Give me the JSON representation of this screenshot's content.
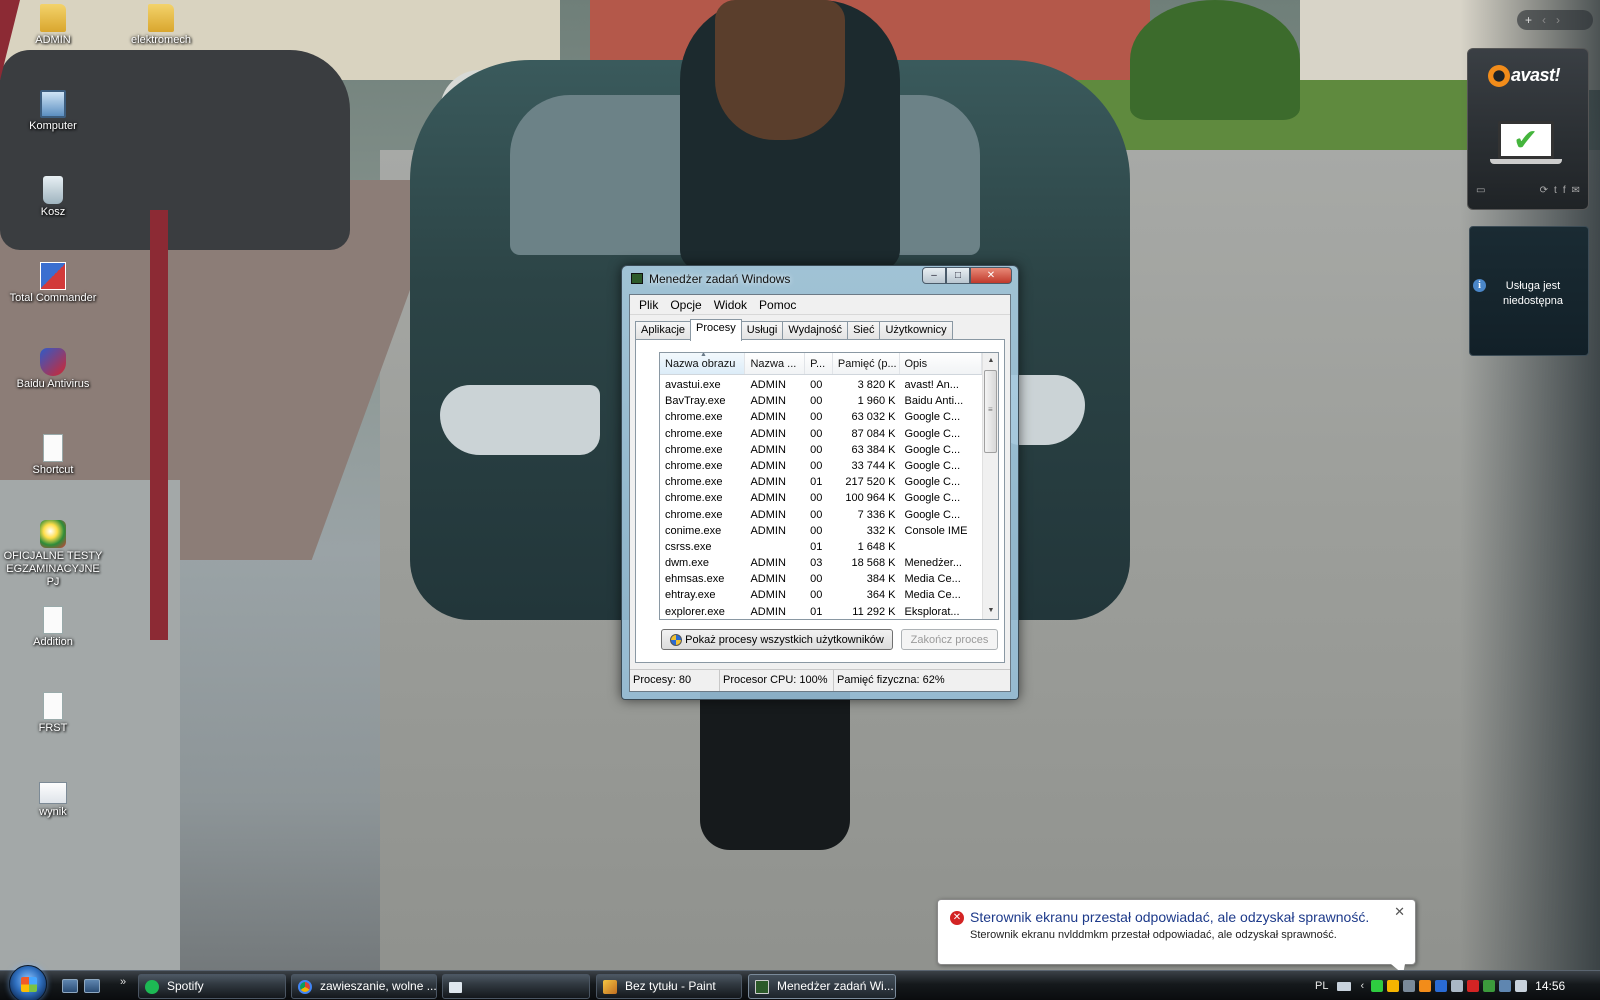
{
  "desktop": {
    "icons": [
      {
        "label": "ADMIN",
        "icon": "folder-icon"
      },
      {
        "label": "Komputer",
        "icon": "computer-icon"
      },
      {
        "label": "Kosz",
        "icon": "recycle-bin-icon"
      },
      {
        "label": "Total Commander",
        "icon": "total-commander-icon"
      },
      {
        "label": "Baidu Antivirus",
        "icon": "baidu-antivirus-icon"
      },
      {
        "label": "Shortcut",
        "icon": "document-icon"
      },
      {
        "label": "OFICJALNE TESTY EGZAMINACYJNE PJ",
        "icon": "exam-app-icon"
      },
      {
        "label": "Addition",
        "icon": "document-icon"
      },
      {
        "label": "FRST",
        "icon": "document-icon"
      },
      {
        "label": "wynik",
        "icon": "image-file-icon"
      }
    ],
    "top_icons": [
      {
        "label": "elektromech",
        "icon": "folder-icon"
      }
    ]
  },
  "task_manager": {
    "title": "Menedżer zadań Windows",
    "window_controls": {
      "minimize": "–",
      "maximize": "□",
      "close": "✕"
    },
    "menu": [
      "Plik",
      "Opcje",
      "Widok",
      "Pomoc"
    ],
    "tabs": [
      "Aplikacje",
      "Procesy",
      "Usługi",
      "Wydajność",
      "Sieć",
      "Użytkownicy"
    ],
    "active_tab": "Procesy",
    "columns": [
      "Nazwa obrazu",
      "Nazwa ...",
      "P...",
      "Pamięć (p...",
      "Opis"
    ],
    "sort_indicator": "▲",
    "rows": [
      {
        "name": "avastui.exe",
        "user": "ADMIN",
        "cpu": "00",
        "mem": "3 820 K",
        "desc": "avast! An..."
      },
      {
        "name": "BavTray.exe",
        "user": "ADMIN",
        "cpu": "00",
        "mem": "1 960 K",
        "desc": "Baidu Anti..."
      },
      {
        "name": "chrome.exe",
        "user": "ADMIN",
        "cpu": "00",
        "mem": "63 032 K",
        "desc": "Google C..."
      },
      {
        "name": "chrome.exe",
        "user": "ADMIN",
        "cpu": "00",
        "mem": "87 084 K",
        "desc": "Google C..."
      },
      {
        "name": "chrome.exe",
        "user": "ADMIN",
        "cpu": "00",
        "mem": "63 384 K",
        "desc": "Google C..."
      },
      {
        "name": "chrome.exe",
        "user": "ADMIN",
        "cpu": "00",
        "mem": "33 744 K",
        "desc": "Google C..."
      },
      {
        "name": "chrome.exe",
        "user": "ADMIN",
        "cpu": "01",
        "mem": "217 520 K",
        "desc": "Google C..."
      },
      {
        "name": "chrome.exe",
        "user": "ADMIN",
        "cpu": "00",
        "mem": "100 964 K",
        "desc": "Google C..."
      },
      {
        "name": "chrome.exe",
        "user": "ADMIN",
        "cpu": "00",
        "mem": "7 336 K",
        "desc": "Google C..."
      },
      {
        "name": "conime.exe",
        "user": "ADMIN",
        "cpu": "00",
        "mem": "332 K",
        "desc": "Console IME"
      },
      {
        "name": "csrss.exe",
        "user": "",
        "cpu": "01",
        "mem": "1 648 K",
        "desc": ""
      },
      {
        "name": "dwm.exe",
        "user": "ADMIN",
        "cpu": "03",
        "mem": "18 568 K",
        "desc": "Menedżer..."
      },
      {
        "name": "ehmsas.exe",
        "user": "ADMIN",
        "cpu": "00",
        "mem": "384 K",
        "desc": "Media Ce..."
      },
      {
        "name": "ehtray.exe",
        "user": "ADMIN",
        "cpu": "00",
        "mem": "364 K",
        "desc": "Media Ce..."
      },
      {
        "name": "explorer.exe",
        "user": "ADMIN",
        "cpu": "01",
        "mem": "11 292 K",
        "desc": "Eksplorat..."
      }
    ],
    "scroll": {
      "up": "▲",
      "down": "▼",
      "grip": "≡"
    },
    "show_all_button": "Pokaż procesy wszystkich użytkowników",
    "end_process_button": "Zakończ proces",
    "status": {
      "processes": "Procesy: 80",
      "cpu": "Procesor CPU: 100%",
      "memory": "Pamięć fizyczna: 62%"
    }
  },
  "avast": {
    "toolbar": {
      "add": "+",
      "prev": "‹",
      "next": "›"
    },
    "logo_text": "avast!",
    "check": "✔",
    "footer_left": "▭",
    "social": [
      "⟳",
      "t",
      "f",
      "✉"
    ]
  },
  "service_gadget": {
    "info": "i",
    "text": "Usługa jest niedostępna"
  },
  "notification": {
    "icon": "✕",
    "title": "Sterownik ekranu przestał odpowiadać, ale odzyskał sprawność.",
    "body": "Sterownik ekranu nvlddmkm przestał odpowiadać, ale odzyskał sprawność.",
    "close": "✕"
  },
  "taskbar": {
    "chevron": "»",
    "buttons": [
      {
        "label": "Spotify",
        "icon": "spotify-icon"
      },
      {
        "label": "zawieszanie, wolne ...",
        "icon": "chrome-icon"
      },
      {
        "label": "",
        "icon": "window-icon"
      },
      {
        "label": "Bez tytułu - Paint",
        "icon": "paint-icon"
      },
      {
        "label": "Menedżer zadań Wi...",
        "icon": "task-manager-icon"
      }
    ],
    "tray": {
      "language": "PL",
      "arrow": "‹",
      "time": "14:56"
    }
  }
}
